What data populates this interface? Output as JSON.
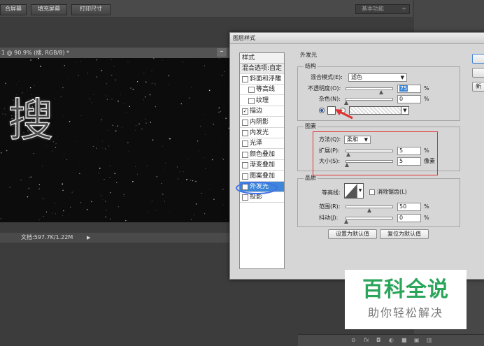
{
  "toolbar": {
    "buttons": [
      "合屏幕",
      "填充屏幕",
      "打印尺寸"
    ],
    "workspace": "基本功能",
    "workspace_arrow": "÷"
  },
  "document": {
    "tab_title": "1 @ 90.9% (搜, RGB/8) *",
    "minimize": "–",
    "canvas_char": "搜",
    "status_info": "文档:597.7K/1.22M",
    "status_arrow": "▶"
  },
  "dialog": {
    "title": "图层样式",
    "styles_header": "样式",
    "blend_options": "混合选项:自定",
    "style_items": [
      {
        "label": "斜面和浮雕",
        "checked": false,
        "sub": false
      },
      {
        "label": "等高线",
        "checked": false,
        "sub": true
      },
      {
        "label": "纹理",
        "checked": false,
        "sub": true
      },
      {
        "label": "描边",
        "checked": true,
        "sub": false
      },
      {
        "label": "内阴影",
        "checked": false,
        "sub": false
      },
      {
        "label": "内发光",
        "checked": false,
        "sub": false
      },
      {
        "label": "光泽",
        "checked": false,
        "sub": false
      },
      {
        "label": "颜色叠加",
        "checked": false,
        "sub": false
      },
      {
        "label": "渐变叠加",
        "checked": false,
        "sub": false
      },
      {
        "label": "图案叠加",
        "checked": false,
        "sub": false
      },
      {
        "label": "外发光",
        "checked": true,
        "sub": false,
        "active": true
      },
      {
        "label": "投影",
        "checked": false,
        "sub": false
      }
    ],
    "outer_glow": {
      "title": "外发光",
      "structure": {
        "title": "结构",
        "blend_mode_label": "混合模式(E):",
        "blend_mode_value": "滤色",
        "opacity_label": "不透明度(O):",
        "opacity_value": "75",
        "opacity_unit": "%",
        "opacity_level": 0.75,
        "noise_label": "杂色(N):",
        "noise_value": "0",
        "noise_unit": "%",
        "noise_level": 0.0,
        "glow_color": "#ffffff"
      },
      "elements": {
        "title": "图素",
        "technique_label": "方法(Q):",
        "technique_value": "柔和",
        "spread_label": "扩展(P):",
        "spread_value": "5",
        "spread_unit": "%",
        "spread_level": 0.05,
        "size_label": "大小(S):",
        "size_value": "5",
        "size_unit": "像素",
        "size_level": 0.02
      },
      "quality": {
        "title": "品质",
        "contour_label": "等高线:",
        "anti_alias_label": "消除锯齿(L)",
        "range_label": "范围(R):",
        "range_value": "50",
        "range_unit": "%",
        "range_level": 0.5,
        "jitter_label": "抖动(J):",
        "jitter_value": "0",
        "jitter_unit": "%",
        "jitter_level": 0.0
      },
      "make_default": "设置为默认值",
      "reset_default": "复位为默认值"
    },
    "right_buttons": [
      "",
      "",
      "新"
    ]
  },
  "watermark": {
    "big": "百科全说",
    "small": "助你轻松解决"
  },
  "colors": {
    "accent": "#3d86d9",
    "annotation_red": "#e03030",
    "annotation_blue": "#4070e8",
    "watermark_green": "#2aa55a"
  }
}
